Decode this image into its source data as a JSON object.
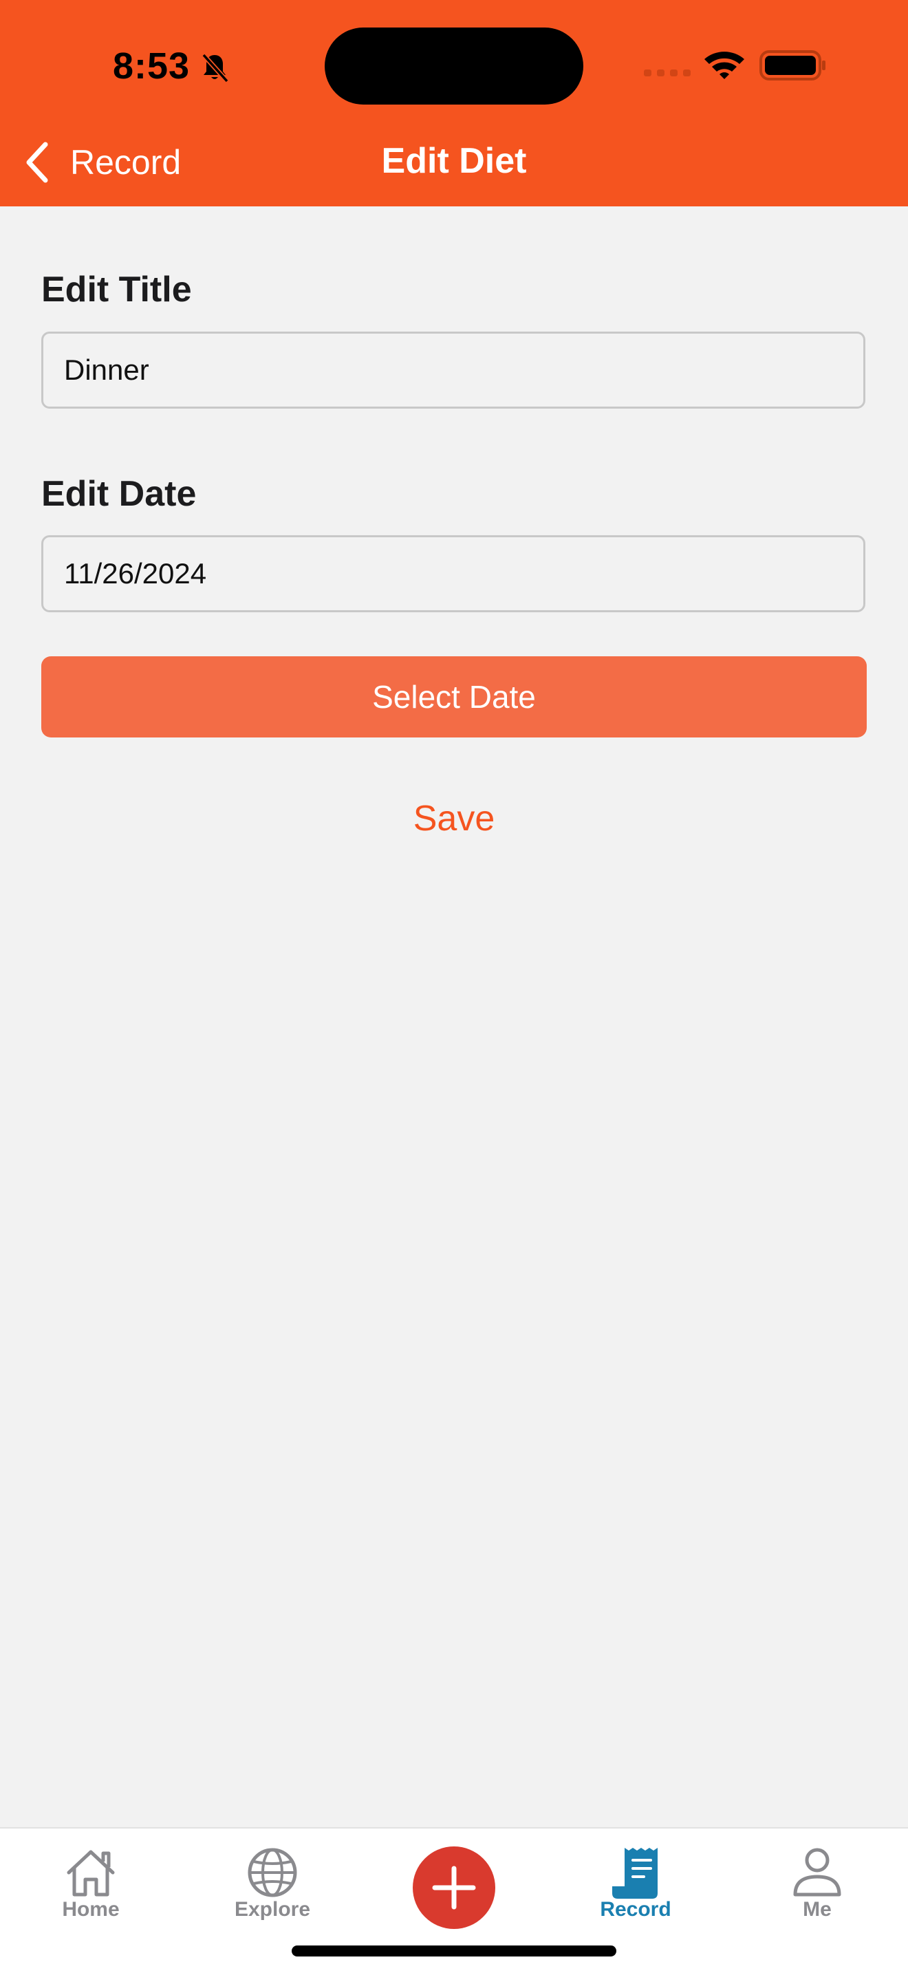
{
  "status_bar": {
    "time": "8:53"
  },
  "nav": {
    "back_label": "Record",
    "title": "Edit Diet"
  },
  "form": {
    "title_label": "Edit Title",
    "title_value": "Dinner",
    "date_label": "Edit Date",
    "date_value": "11/26/2024",
    "select_date_label": "Select Date",
    "save_label": "Save"
  },
  "tabs": [
    {
      "label": "Home",
      "icon": "home-icon"
    },
    {
      "label": "Explore",
      "icon": "globe-icon"
    },
    {
      "label": "",
      "icon": "plus-icon"
    },
    {
      "label": "Record",
      "icon": "receipt-icon",
      "active": true
    },
    {
      "label": "Me",
      "icon": "person-icon"
    }
  ],
  "colors": {
    "brand": "#f5541f",
    "button": "#f36c46",
    "add": "#d93a2e",
    "active_tab": "#1a7fb0",
    "inactive_tab": "#8a8a8e"
  }
}
